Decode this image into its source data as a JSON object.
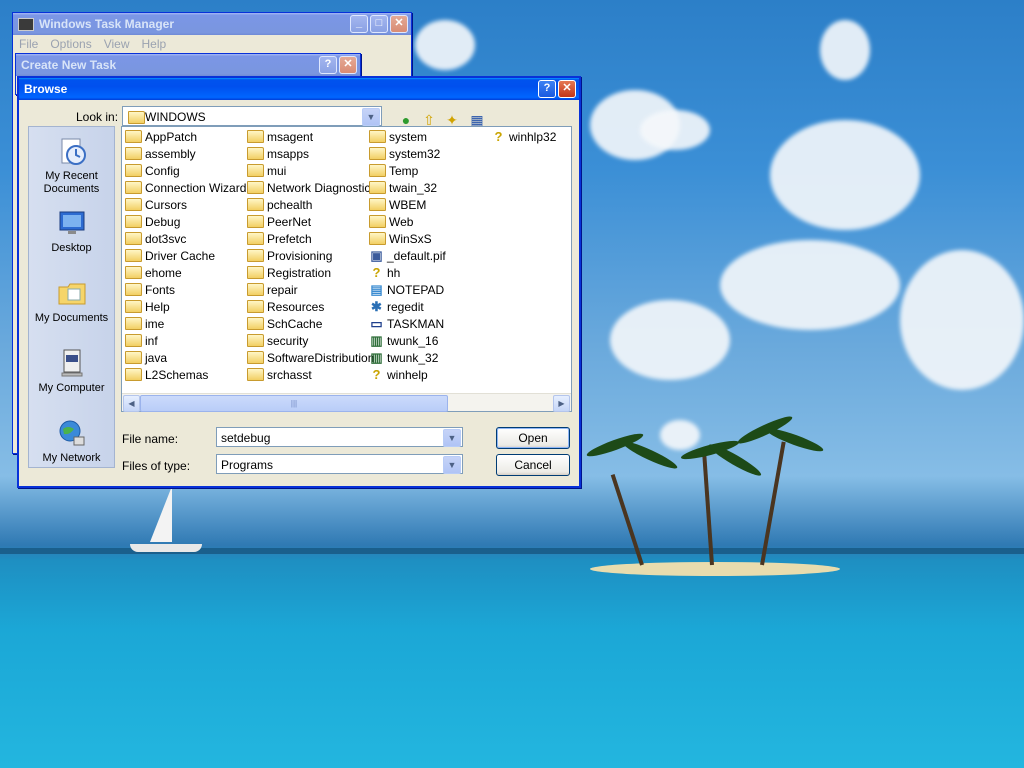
{
  "task_manager": {
    "title": "Windows Task Manager",
    "menu": [
      "File",
      "Options",
      "View",
      "Help"
    ]
  },
  "create_task": {
    "title": "Create New Task"
  },
  "browse": {
    "title": "Browse",
    "look_in_label": "Look in:",
    "look_in_value": "WINDOWS",
    "places": [
      {
        "label": "My Recent Documents",
        "icon": "recent-documents-icon"
      },
      {
        "label": "Desktop",
        "icon": "desktop-icon"
      },
      {
        "label": "My Documents",
        "icon": "my-documents-icon"
      },
      {
        "label": "My Computer",
        "icon": "my-computer-icon"
      },
      {
        "label": "My Network",
        "icon": "my-network-icon"
      }
    ],
    "columns": [
      [
        {
          "name": "AppPatch",
          "type": "folder"
        },
        {
          "name": "assembly",
          "type": "folder"
        },
        {
          "name": "Config",
          "type": "folder"
        },
        {
          "name": "Connection Wizard",
          "type": "folder"
        },
        {
          "name": "Cursors",
          "type": "folder"
        },
        {
          "name": "Debug",
          "type": "folder"
        },
        {
          "name": "dot3svc",
          "type": "folder"
        },
        {
          "name": "Driver Cache",
          "type": "folder"
        },
        {
          "name": "ehome",
          "type": "folder"
        },
        {
          "name": "Fonts",
          "type": "folder"
        },
        {
          "name": "Help",
          "type": "folder"
        },
        {
          "name": "ime",
          "type": "folder"
        },
        {
          "name": "inf",
          "type": "folder"
        },
        {
          "name": "java",
          "type": "folder"
        },
        {
          "name": "L2Schemas",
          "type": "folder"
        }
      ],
      [
        {
          "name": "msagent",
          "type": "folder"
        },
        {
          "name": "msapps",
          "type": "folder"
        },
        {
          "name": "mui",
          "type": "folder"
        },
        {
          "name": "Network Diagnostic",
          "type": "folder"
        },
        {
          "name": "pchealth",
          "type": "folder"
        },
        {
          "name": "PeerNet",
          "type": "folder"
        },
        {
          "name": "Prefetch",
          "type": "folder"
        },
        {
          "name": "Provisioning",
          "type": "folder"
        },
        {
          "name": "Registration",
          "type": "folder"
        },
        {
          "name": "repair",
          "type": "folder"
        },
        {
          "name": "Resources",
          "type": "folder"
        },
        {
          "name": "SchCache",
          "type": "folder"
        },
        {
          "name": "security",
          "type": "folder"
        },
        {
          "name": "SoftwareDistribution",
          "type": "folder"
        },
        {
          "name": "srchasst",
          "type": "folder"
        }
      ],
      [
        {
          "name": "system",
          "type": "folder"
        },
        {
          "name": "system32",
          "type": "folder"
        },
        {
          "name": "Temp",
          "type": "folder"
        },
        {
          "name": "twain_32",
          "type": "folder"
        },
        {
          "name": "WBEM",
          "type": "folder"
        },
        {
          "name": "Web",
          "type": "folder"
        },
        {
          "name": "WinSxS",
          "type": "folder"
        },
        {
          "name": "_default.pif",
          "type": "pif-icon"
        },
        {
          "name": "hh",
          "type": "help-icon"
        },
        {
          "name": "NOTEPAD",
          "type": "notepad-icon"
        },
        {
          "name": "regedit",
          "type": "regedit-icon"
        },
        {
          "name": "TASKMAN",
          "type": "window-icon"
        },
        {
          "name": "twunk_16",
          "type": "scanner-icon"
        },
        {
          "name": "twunk_32",
          "type": "scanner-icon"
        },
        {
          "name": "winhelp",
          "type": "help-icon"
        }
      ],
      [
        {
          "name": "winhlp32",
          "type": "help-icon"
        }
      ]
    ],
    "file_name_label": "File name:",
    "file_name_value": "setdebug",
    "file_type_label": "Files of type:",
    "file_type_value": "Programs",
    "open_label": "Open",
    "cancel_label": "Cancel",
    "help_glyph": "?",
    "close_glyph": "✕"
  }
}
